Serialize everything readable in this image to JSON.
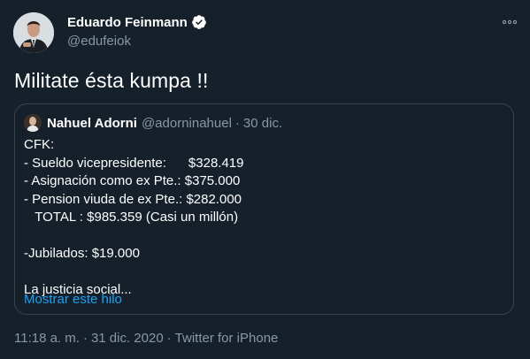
{
  "author": {
    "name": "Eduardo Feinmann",
    "handle": "@edufeiok"
  },
  "tweet": {
    "text": "Militate ésta kumpa !!"
  },
  "quoted": {
    "author_name": "Nahuel Adorni",
    "author_handle": "@adorninahuel",
    "separator": "·",
    "date": "30 dic.",
    "lines": [
      "CFK:",
      "- Sueldo vicepresidente:      $328.419",
      "- Asignación como ex Pte.: $375.000",
      "- Pension viuda de ex Pte.: $282.000",
      "   TOTAL : $985.359 (Casi un millón)",
      "",
      "-Jubilados: $19.000",
      "",
      "La justicia social..."
    ],
    "show_thread_label": "Mostrar este hilo"
  },
  "meta": {
    "time": "11:18 a. m.",
    "dot": "·",
    "date": "31 dic. 2020",
    "source": "Twitter for iPhone"
  },
  "colors": {
    "background": "#15202b",
    "secondary_text": "#8899a6",
    "link": "#1da1f2",
    "border": "#38444d"
  },
  "icons": {
    "verified": "verified-badge-icon",
    "more": "more-options-icon"
  }
}
